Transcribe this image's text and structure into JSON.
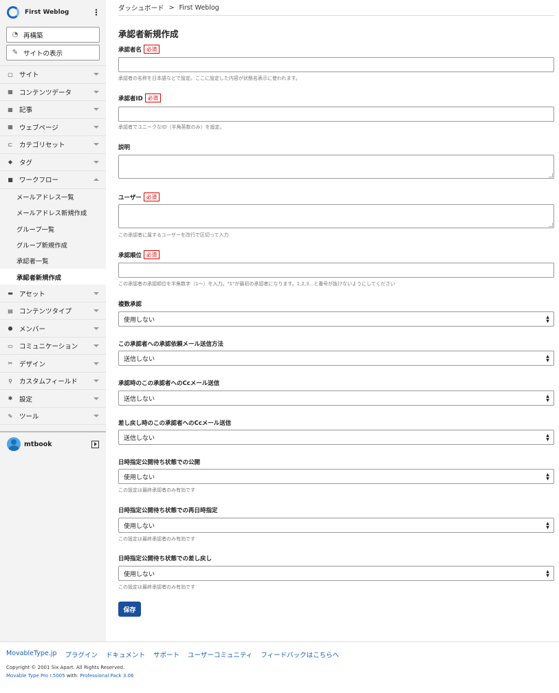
{
  "site": {
    "name": "First Weblog"
  },
  "sidebar": {
    "buttons": [
      {
        "label": "再構築",
        "icon": "rebuild-icon"
      },
      {
        "label": "サイトの表示",
        "icon": "view-site-icon"
      }
    ],
    "items": [
      {
        "label": "サイト",
        "icon": "site-icon"
      },
      {
        "label": "コンテンツデータ",
        "icon": "content-data-icon"
      },
      {
        "label": "記事",
        "icon": "entry-icon"
      },
      {
        "label": "ウェブページ",
        "icon": "webpage-icon"
      },
      {
        "label": "カテゴリセット",
        "icon": "category-set-icon"
      },
      {
        "label": "タグ",
        "icon": "tag-icon"
      },
      {
        "label": "ワークフロー",
        "icon": "workflow-icon"
      },
      {
        "label": "アセット",
        "icon": "asset-icon"
      },
      {
        "label": "コンテンツタイプ",
        "icon": "content-type-icon"
      },
      {
        "label": "メンバー",
        "icon": "member-icon"
      },
      {
        "label": "コミュニケーション",
        "icon": "communication-icon"
      },
      {
        "label": "デザイン",
        "icon": "design-icon"
      },
      {
        "label": "カスタムフィールド",
        "icon": "custom-field-icon"
      },
      {
        "label": "設定",
        "icon": "settings-icon"
      },
      {
        "label": "ツール",
        "icon": "tools-icon"
      }
    ],
    "workflow_sub": [
      "メールアドレス一覧",
      "メールアドレス新規作成",
      "グループ一覧",
      "グループ新規作成",
      "承認者一覧",
      "承認者新規作成"
    ],
    "user": "mtbook"
  },
  "breadcrumb": {
    "home": "ダッシュボード",
    "sep": ">",
    "current": "First Weblog"
  },
  "page": {
    "title": "承認者新規作成"
  },
  "required_badge": "必須",
  "form": {
    "name": {
      "label": "承認者名",
      "hint": "承認者の名称を日本語などで設定。ここに設定した内容が状態名表示に使われます。"
    },
    "id": {
      "label": "承認者ID",
      "hint": "承認者でユニークなID（半角英数のみ）を設定。"
    },
    "description": {
      "label": "説明"
    },
    "users": {
      "label": "ユーザー",
      "hint": "この承認者に属するユーザーを改行で区切って入力"
    },
    "order": {
      "label": "承認順位",
      "hint": "この承認者の承認順位を半角数字（1〜）を入力。\"1\"が最初の承認者になります。1,2,3...と番号が抜けないようにしてください"
    },
    "multi": {
      "label": "複数承認",
      "value": "使用しない"
    },
    "mail_method": {
      "label": "この承認者への承認依頼メール送信方法",
      "value": "送信しない"
    },
    "cc_approve": {
      "label": "承認時のこの承認者へのCcメール送信",
      "value": "送信しない"
    },
    "cc_reject": {
      "label": "差し戻し時のこの承認者へのCcメール送信",
      "value": "送信しない"
    },
    "sched_publish": {
      "label": "日時指定公開待ち状態での公開",
      "value": "使用しない",
      "hint": "この設定は最終承認者のみ有効です"
    },
    "sched_redate": {
      "label": "日時指定公開待ち状態での再日時指定",
      "value": "使用しない",
      "hint": "この設定は最終承認者のみ有効です"
    },
    "sched_reject": {
      "label": "日時指定公開待ち状態での差し戻し",
      "value": "使用しない",
      "hint": "この設定は最終承認者のみ有効です"
    },
    "save_label": "保存"
  },
  "footer": {
    "links": [
      "MovableType.jp",
      "プラグイン",
      "ドキュメント",
      "サポート",
      "ユーザーコミュニティ",
      "フィードバックはこちらへ"
    ],
    "copyright": "Copyright © 2001 Six Apart. All Rights Reserved.",
    "version_a": "Movable Type Pro r.5005",
    "version_with": " with: ",
    "version_b": "Professional Pack 3.06"
  }
}
